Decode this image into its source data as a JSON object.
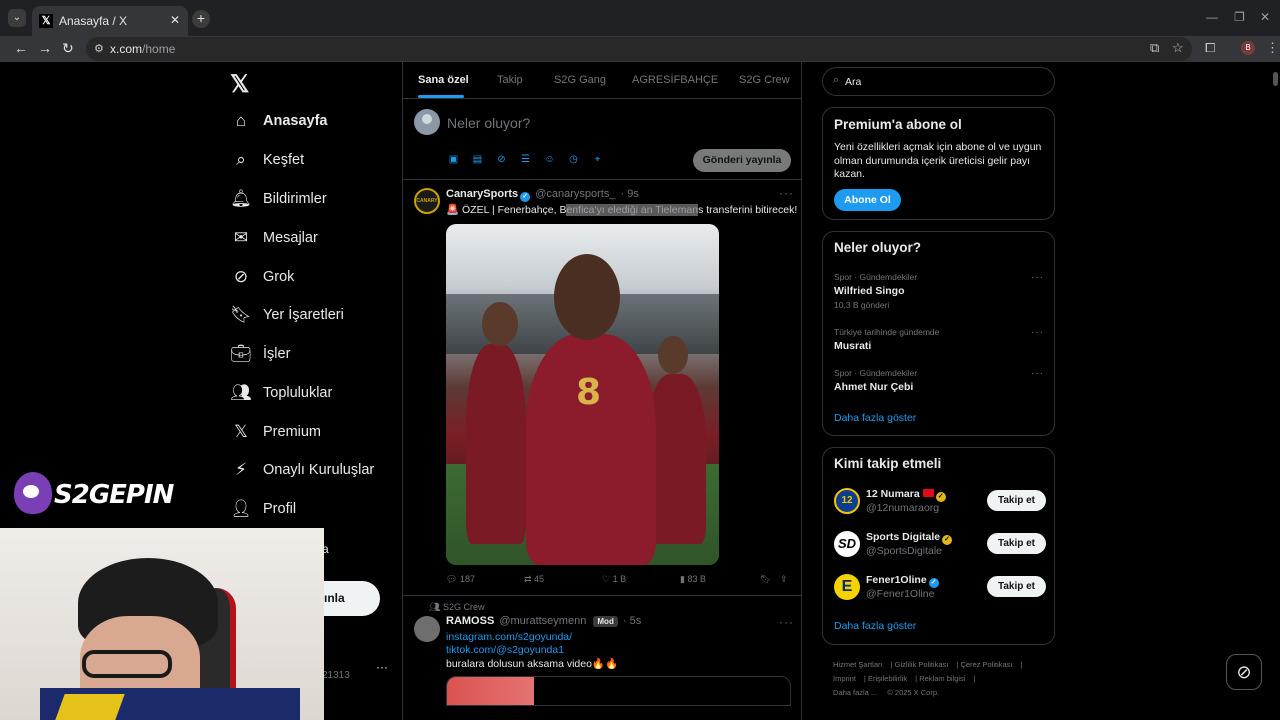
{
  "browser": {
    "tab_title": "Anasayfa / X",
    "url_host": "x.com",
    "url_path": "/home",
    "profile_initial": "B"
  },
  "nav": {
    "items": [
      {
        "label": "Anasayfa",
        "icon": "home-icon",
        "active": true
      },
      {
        "label": "Keşfet",
        "icon": "search-icon"
      },
      {
        "label": "Bildirimler",
        "icon": "bell-icon"
      },
      {
        "label": "Mesajlar",
        "icon": "mail-icon"
      },
      {
        "label": "Grok",
        "icon": "grok-icon"
      },
      {
        "label": "Yer İşaretleri",
        "icon": "bookmark-icon"
      },
      {
        "label": "İşler",
        "icon": "briefcase-icon"
      },
      {
        "label": "Topluluklar",
        "icon": "people-icon"
      },
      {
        "label": "Premium",
        "icon": "x-icon"
      },
      {
        "label": "Onaylı Kuruluşlar",
        "icon": "lightning-icon"
      },
      {
        "label": "Profil",
        "icon": "person-icon"
      }
    ],
    "post_button_fragment": "ınla",
    "more_fragment": "a",
    "account_handle_fragment": "21313"
  },
  "feed": {
    "tabs": [
      "Sana özel",
      "Takip",
      "S2G Gang",
      "AGRESİFBAHÇE",
      "S2G Crew"
    ],
    "compose_placeholder": "Neler oluyor?",
    "post_button": "Gönderi yayınla",
    "tweet1": {
      "name": "CanarySports",
      "handle": "@canarysports_",
      "time": "· 9s",
      "avatar_text": "CANARY",
      "text_before": "🚨 ÖZEL | Fenerbahçe, B",
      "text_highlight": "enfica'yı elediği an Tieleman",
      "text_after": "s transferini bitirecek!",
      "jersey_number": "8",
      "replies": "187",
      "retweets": "45",
      "likes": "1 B",
      "views": "83 B"
    },
    "tweet2": {
      "context": "S2G Crew",
      "name": "RAMOSS",
      "handle": "@murattseymenn",
      "badge": "Mod",
      "time": "· 5s",
      "link1": "instagram.com/s2goyunda/",
      "link2": "tiktok.com/@s2goyunda1",
      "text": "buralara dolusun aksama video🔥🔥"
    }
  },
  "right": {
    "search_value": "Ara",
    "premium": {
      "title": "Premium'a abone ol",
      "text": "Yeni özellikleri açmak için abone ol ve uygun olman durumunda içerik üreticisi gelir payı kazan.",
      "button": "Abone Ol"
    },
    "trends": {
      "title": "Neler oluyor?",
      "items": [
        {
          "meta": "Spor · Gündemdekiler",
          "name": "Wilfried Singo",
          "count": "10,3 B gönderi"
        },
        {
          "meta": "Türkiye tarihinde gündemde",
          "name": "Musrati",
          "count": ""
        },
        {
          "meta": "Spor · Gündemdekiler",
          "name": "Ahmet Nur Çebi",
          "count": ""
        }
      ],
      "show_more": "Daha fazla göster"
    },
    "who_to_follow": {
      "title": "Kimi takip etmeli",
      "items": [
        {
          "name": "12 Numara",
          "handle": "@12numaraorg",
          "button": "Takip et",
          "avatar_text": "12"
        },
        {
          "name": "Sports Digitale",
          "handle": "@SportsDigitale",
          "button": "Takip et",
          "avatar_text": "SD"
        },
        {
          "name": "Fener1Oline",
          "handle": "@Fener1Oline",
          "button": "Takip et",
          "avatar_text": "E"
        }
      ],
      "show_more": "Daha fazla göster"
    },
    "footer": [
      "Hizmet Şartları",
      "Gizlilik Politikası",
      "Çerez Politikası",
      "Imprint",
      "Erişilebilirlik",
      "Reklam bilgisi",
      "Daha fazla ...",
      "© 2025 X Corp."
    ]
  },
  "overlay": {
    "watermark_text": "S2GEPIN"
  }
}
